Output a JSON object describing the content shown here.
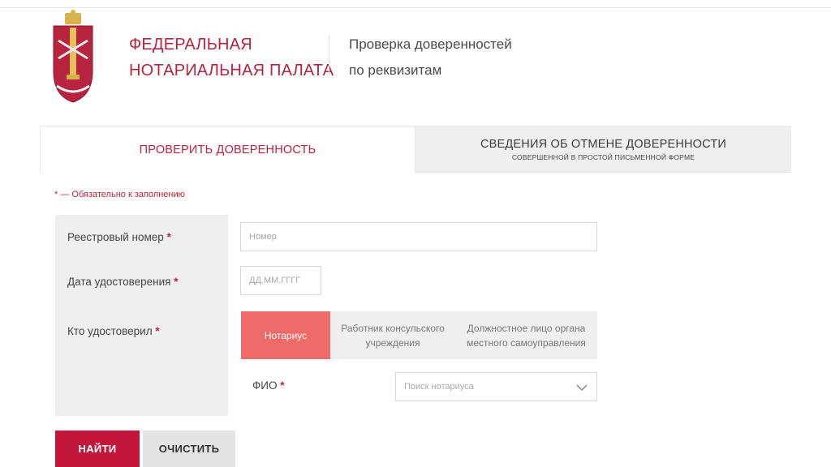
{
  "header": {
    "org_name_line1": "ФЕДЕРАЛЬНАЯ",
    "org_name_line2": "НОТАРИАЛЬНАЯ ПАЛАТА",
    "service_title_line1": "Проверка доверенностей",
    "service_title_line2": "по реквизитам",
    "logo_icon": "notary-chamber-emblem-icon"
  },
  "tabs": [
    {
      "label": "ПРОВЕРИТЬ ДОВЕРЕННОСТЬ",
      "active": true
    },
    {
      "label": "СВЕДЕНИЯ ОБ ОТМЕНЕ ДОВЕРЕННОСТИ",
      "sublabel": "СОВЕРШЕННОЙ В ПРОСТОЙ ПИСЬМЕННОЙ ФОРМЕ",
      "active": false
    }
  ],
  "form": {
    "required_note": "* — Обязательно к заполнению",
    "registry_number": {
      "label": "Реестровый номер",
      "required_mark": "*",
      "placeholder": "Номер",
      "value": ""
    },
    "certification_date": {
      "label": "Дата удостоверения",
      "required_mark": "*",
      "placeholder": "ДД.ММ.ГГГГ",
      "value": ""
    },
    "certified_by": {
      "label": "Кто удостоверил",
      "required_mark": "*",
      "options": [
        {
          "label": "Нотариус",
          "selected": true
        },
        {
          "label_line1": "Работник консульского",
          "label_line2": "учреждения",
          "selected": false
        },
        {
          "label_line1": "Должностное лицо органа",
          "label_line2": "местного самоуправления",
          "selected": false
        }
      ]
    },
    "fio": {
      "label": "ФИО",
      "required_mark": "*",
      "placeholder": "Поиск нотариуса",
      "icon": "chevron-down-icon"
    }
  },
  "buttons": {
    "find": "НАЙТИ",
    "clear": "ОЧИСТИТЬ"
  },
  "colors": {
    "brand": "#c2163a",
    "accent_selected": "#ef6b69",
    "panel": "#efefef"
  }
}
